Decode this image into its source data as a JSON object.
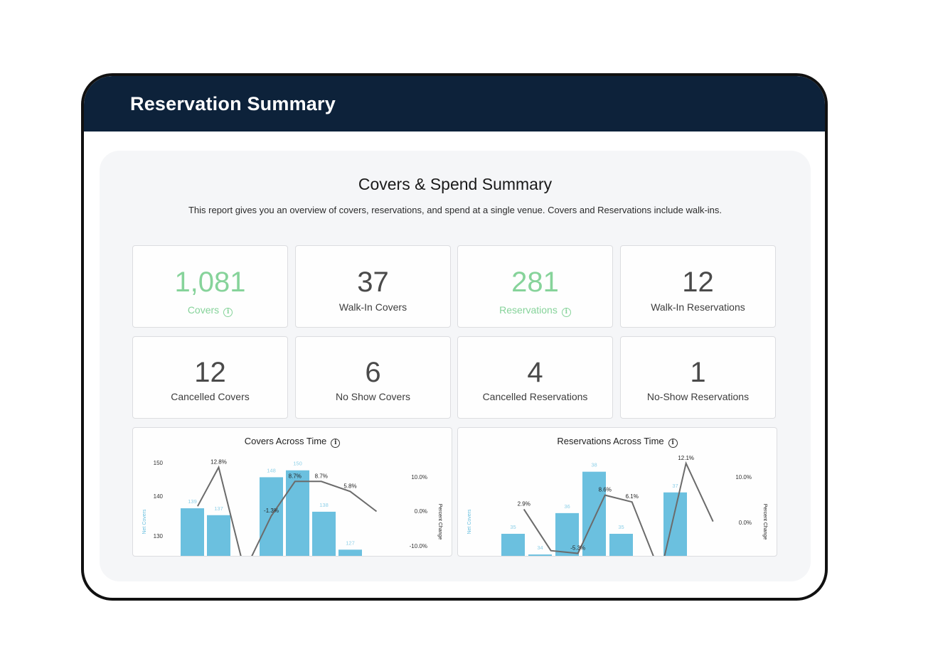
{
  "header": {
    "title": "Reservation Summary"
  },
  "report": {
    "title": "Covers & Spend Summary",
    "description": "This report gives you an overview of covers, reservations, and spend at a single venue. Covers and Reservations include walk-ins."
  },
  "colors": {
    "header_bg": "#0d223a",
    "accent_green": "#86d39a",
    "bar_blue": "#6bc0df",
    "line_gray": "#6b6b6b"
  },
  "tiles": [
    {
      "value": "1,081",
      "label": "Covers",
      "info": true,
      "highlight": true
    },
    {
      "value": "37",
      "label": "Walk-In Covers",
      "info": false,
      "highlight": false
    },
    {
      "value": "281",
      "label": "Reservations",
      "info": true,
      "highlight": true
    },
    {
      "value": "12",
      "label": "Walk-In Reservations",
      "info": false,
      "highlight": false
    },
    {
      "value": "12",
      "label": "Cancelled Covers",
      "info": false,
      "highlight": false
    },
    {
      "value": "6",
      "label": "No Show Covers",
      "info": false,
      "highlight": false
    },
    {
      "value": "4",
      "label": "Cancelled Reservations",
      "info": false,
      "highlight": false
    },
    {
      "value": "1",
      "label": "No-Show Reservations",
      "info": false,
      "highlight": false
    }
  ],
  "info_icon": "info-circle-icon",
  "chart_data": [
    {
      "type": "bar",
      "title": "Covers Across Time",
      "ylabel": "Net Covers",
      "y2label": "Percent Change",
      "yticks": [
        "150",
        "140",
        "130"
      ],
      "y2ticks": [
        "10.0%",
        "0.0%",
        "-10.0%"
      ],
      "ylim": [
        125,
        152
      ],
      "y2lim": [
        -12.8,
        13.2
      ],
      "slots": 8,
      "bars": [
        {
          "slot": 0,
          "value": 139
        },
        {
          "slot": 1,
          "value": 137
        },
        {
          "slot": 3,
          "value": 148
        },
        {
          "slot": 4,
          "value": 150
        },
        {
          "slot": 5,
          "value": 138
        },
        {
          "slot": 6,
          "value": 127
        }
      ],
      "line": [
        {
          "slot": 0.2,
          "value": 1.5,
          "label": ""
        },
        {
          "slot": 1,
          "value": 12.8,
          "label": "12.8%"
        },
        {
          "slot": 1.85,
          "value": -13.5,
          "label": ""
        },
        {
          "slot": 2.25,
          "value": -13.5,
          "label": ""
        },
        {
          "slot": 3,
          "value": -1.3,
          "label": "-1.3%"
        },
        {
          "slot": 3.9,
          "value": 8.7,
          "label": "8.7%"
        },
        {
          "slot": 4.9,
          "value": 8.7,
          "label": "8.7%"
        },
        {
          "slot": 6,
          "value": 5.8,
          "label": "5.8%"
        },
        {
          "slot": 7,
          "value": 0,
          "label": ""
        }
      ]
    },
    {
      "type": "bar",
      "title": "Reservations Across Time",
      "ylabel": "Net Covers",
      "y2label": "Percent Change",
      "yticks": [],
      "y2ticks": [
        "10.0%",
        "0.0%"
      ],
      "ylim": [
        33.9,
        38.4
      ],
      "y2lim": [
        -10,
        14.5
      ],
      "slots": 8,
      "bars": [
        {
          "slot": 0,
          "value": 35
        },
        {
          "slot": 1,
          "value": 34
        },
        {
          "slot": 2,
          "value": 36
        },
        {
          "slot": 3,
          "value": 38
        },
        {
          "slot": 4,
          "value": 35
        },
        {
          "slot": 6,
          "value": 37
        }
      ],
      "line": [
        {
          "slot": 0.4,
          "value": 2.9,
          "label": "2.9%"
        },
        {
          "slot": 1.4,
          "value": -6.2,
          "label": ""
        },
        {
          "slot": 2.4,
          "value": -6.8,
          "label": "-5.3%"
        },
        {
          "slot": 3.4,
          "value": 6.0,
          "label": "8.6%"
        },
        {
          "slot": 4.4,
          "value": 4.5,
          "label": "6.1%"
        },
        {
          "slot": 5.2,
          "value": -10.2,
          "label": ""
        },
        {
          "slot": 5.6,
          "value": -10.2,
          "label": ""
        },
        {
          "slot": 6.4,
          "value": 13.0,
          "label": "12.1%"
        },
        {
          "slot": 7.4,
          "value": 0.2,
          "label": ""
        }
      ]
    }
  ]
}
